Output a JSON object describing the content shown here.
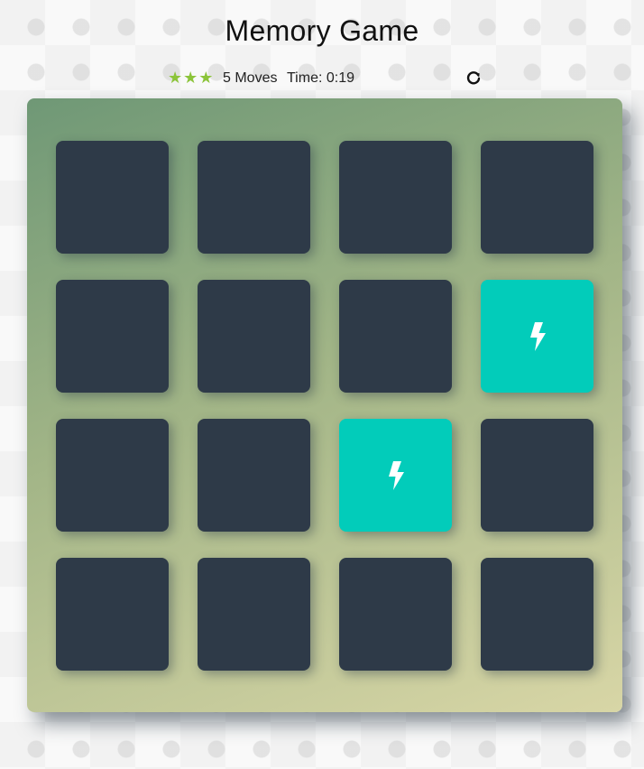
{
  "title": "Memory Game",
  "score": {
    "stars": [
      "★",
      "★",
      "★"
    ],
    "moves_text": "5 Moves",
    "timer_text": "Time: 0:19"
  },
  "colors": {
    "star": "#8cc43a",
    "card_back": "#2e3a48",
    "card_open": "#02ccba"
  },
  "deck": {
    "rows": 4,
    "cols": 4,
    "cards": [
      {
        "state": "closed"
      },
      {
        "state": "closed"
      },
      {
        "state": "closed"
      },
      {
        "state": "closed"
      },
      {
        "state": "closed"
      },
      {
        "state": "closed"
      },
      {
        "state": "closed"
      },
      {
        "state": "open",
        "icon": "bolt-icon"
      },
      {
        "state": "closed"
      },
      {
        "state": "closed"
      },
      {
        "state": "open",
        "icon": "bolt-icon"
      },
      {
        "state": "closed"
      },
      {
        "state": "closed"
      },
      {
        "state": "closed"
      },
      {
        "state": "closed"
      },
      {
        "state": "closed"
      }
    ]
  }
}
